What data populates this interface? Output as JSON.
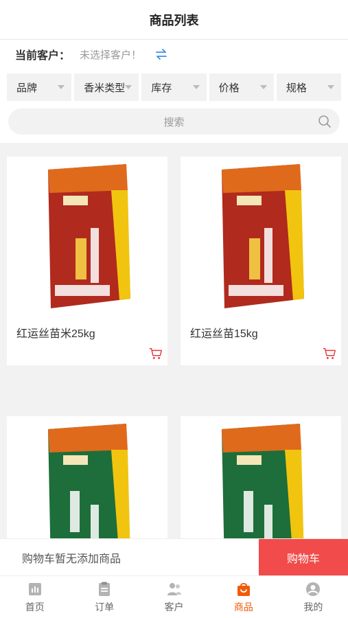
{
  "header": {
    "title": "商品列表"
  },
  "customer": {
    "label": "当前客户：",
    "value": "未选择客户！",
    "switch_icon": "swap-icon"
  },
  "filters": [
    {
      "label": "品牌"
    },
    {
      "label": "香米类型"
    },
    {
      "label": "库存"
    },
    {
      "label": "价格"
    },
    {
      "label": "规格"
    }
  ],
  "search": {
    "placeholder": "搜索"
  },
  "products": [
    {
      "name": "红运丝苗米25kg",
      "bag_color": "#b02a1e"
    },
    {
      "name": "红运丝苗15kg",
      "bag_color": "#b02a1e"
    },
    {
      "name": "",
      "bag_color": "#1d6e3a"
    },
    {
      "name": "",
      "bag_color": "#1d6e3a"
    }
  ],
  "cart_bar": {
    "empty_text": "购物车暂无添加商品",
    "button_label": "购物车"
  },
  "tabbar": [
    {
      "label": "首页",
      "icon": "home-icon",
      "active": false
    },
    {
      "label": "订单",
      "icon": "order-icon",
      "active": false
    },
    {
      "label": "客户",
      "icon": "customer-icon",
      "active": false
    },
    {
      "label": "商品",
      "icon": "product-bag-icon",
      "active": true
    },
    {
      "label": "我的",
      "icon": "profile-icon",
      "active": false
    }
  ],
  "colors": {
    "accent": "#f25a0a",
    "cart_button": "#f14b4b",
    "cart_icon": "#e9383f"
  }
}
